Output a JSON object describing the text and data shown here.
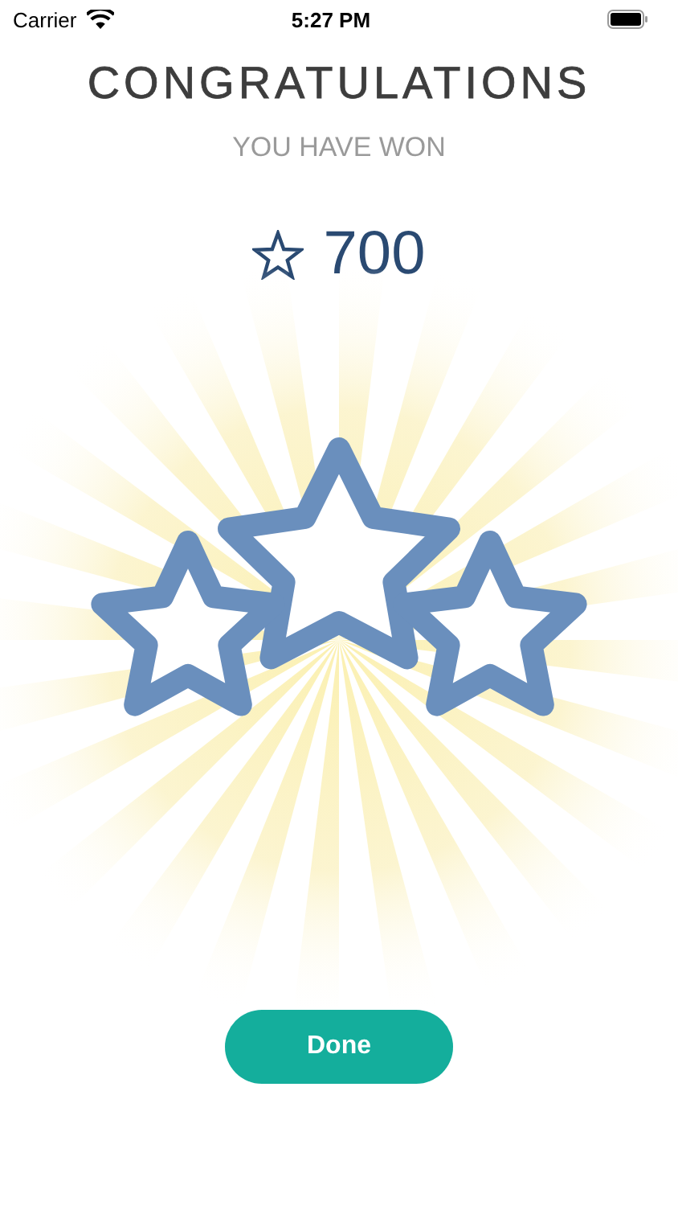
{
  "status_bar": {
    "carrier": "Carrier",
    "time": "5:27 PM"
  },
  "title": "CONGRATULATIONS",
  "subtitle": "YOU HAVE WON",
  "reward": {
    "amount": "700"
  },
  "done_button": {
    "label": "Done"
  }
}
